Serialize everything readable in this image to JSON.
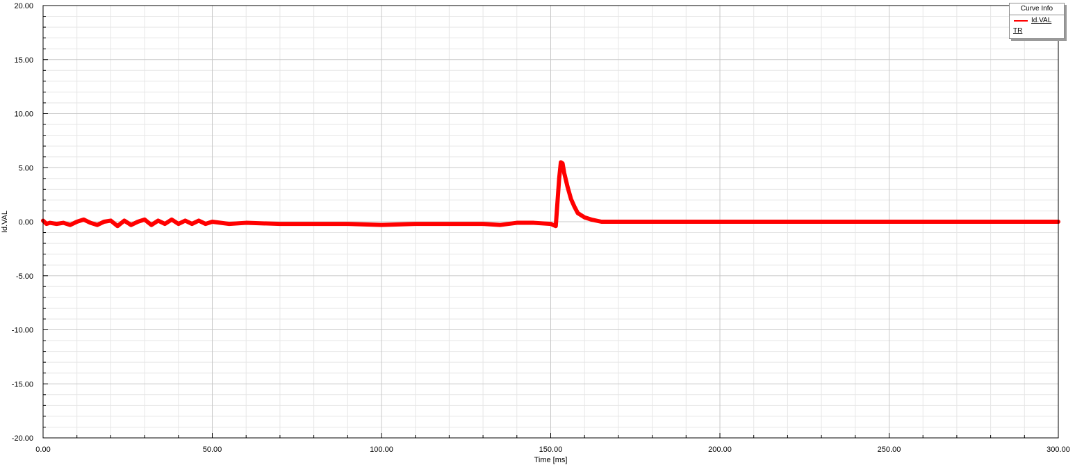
{
  "chart_data": {
    "type": "line",
    "xlabel": "Time [ms]",
    "ylabel": "Id.VAL",
    "xlim": [
      0,
      300
    ],
    "ylim": [
      -20,
      20
    ],
    "x_ticks": [
      "0.00",
      "50.00",
      "100.00",
      "150.00",
      "200.00",
      "250.00",
      "300.00"
    ],
    "y_ticks": [
      "20.00",
      "15.00",
      "10.00",
      "5.00",
      "0.00",
      "-5.00",
      "-10.00",
      "-15.00",
      "-20.00"
    ],
    "grid": true,
    "legend": {
      "title": "Curve Info",
      "placement": "top-right",
      "group": "TR",
      "entries": [
        {
          "name": "Id.VAL",
          "color": "#ff0000"
        }
      ]
    },
    "series": [
      {
        "name": "Id.VAL",
        "color": "#ff0000",
        "x": [
          0,
          1,
          2,
          4,
          6,
          8,
          10,
          12,
          14,
          16,
          18,
          20,
          22,
          24,
          26,
          28,
          30,
          32,
          34,
          36,
          38,
          40,
          42,
          44,
          46,
          48,
          50,
          55,
          60,
          70,
          80,
          90,
          100,
          110,
          120,
          130,
          135,
          140,
          145,
          150,
          151.5,
          152.5,
          153,
          153.5,
          154,
          155,
          156,
          157,
          158,
          160,
          162,
          165,
          170,
          180,
          200,
          220,
          250,
          280,
          300
        ],
        "y": [
          0.1,
          -0.2,
          -0.1,
          -0.2,
          -0.1,
          -0.3,
          0.0,
          0.2,
          -0.1,
          -0.3,
          0.0,
          0.1,
          -0.4,
          0.1,
          -0.3,
          0.0,
          0.2,
          -0.3,
          0.1,
          -0.2,
          0.2,
          -0.2,
          0.1,
          -0.2,
          0.1,
          -0.2,
          0.0,
          -0.2,
          -0.1,
          -0.2,
          -0.2,
          -0.2,
          -0.3,
          -0.2,
          -0.2,
          -0.2,
          -0.3,
          -0.1,
          -0.1,
          -0.2,
          -0.4,
          4.0,
          5.5,
          5.4,
          4.5,
          3.2,
          2.1,
          1.4,
          0.8,
          0.4,
          0.2,
          0.0,
          0.0,
          0.0,
          0.0,
          0.0,
          0.0,
          0.0,
          0.0
        ]
      }
    ]
  }
}
